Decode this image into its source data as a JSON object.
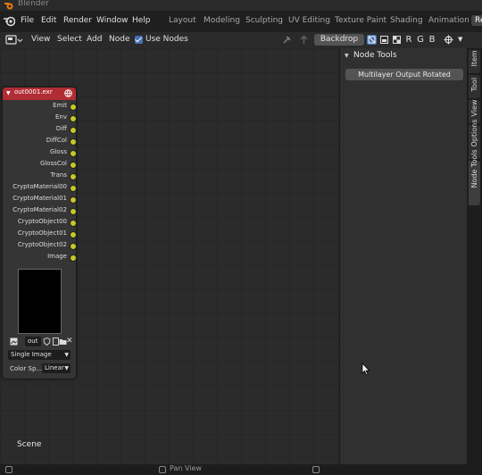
{
  "window": {
    "title": "Blender"
  },
  "menu": [
    "File",
    "Edit",
    "Render",
    "Window",
    "Help"
  ],
  "workspaces": [
    "Layout",
    "Modeling",
    "Sculpting",
    "UV Editing",
    "Texture Paint",
    "Shading",
    "Animation",
    "Re"
  ],
  "header": {
    "items": [
      "View",
      "Select",
      "Add",
      "Node"
    ],
    "use_nodes_label": "Use Nodes",
    "backdrop_label": "Backdrop",
    "channels": [
      "R",
      "G",
      "B"
    ]
  },
  "node": {
    "title": "out0001.exr",
    "outputs": [
      "Emit",
      "Env",
      "Diff",
      "DiffCol",
      "Gloss",
      "GlossCol",
      "Trans",
      "CryptoMaterial00",
      "CryptoMaterial01",
      "CryptoMaterial02",
      "CryptoObject00",
      "CryptoObject01",
      "CryptoObject02",
      "Image"
    ],
    "image_name": "out",
    "source": "Single Image",
    "color_space_label": "Color Sp...",
    "color_space_value": "Linear"
  },
  "scene_label": "Scene",
  "sidebar": {
    "panel_title": "Node Tools",
    "button_label": "Multilayer Output Rotated",
    "tabs": [
      "Item",
      "Tool",
      "View",
      "Options",
      "Node Tools"
    ]
  },
  "status": {
    "text": "Pan View"
  },
  "colors": {
    "accent": "#4772b3",
    "node_header": "#b12d35",
    "socket": "#c7c729"
  }
}
